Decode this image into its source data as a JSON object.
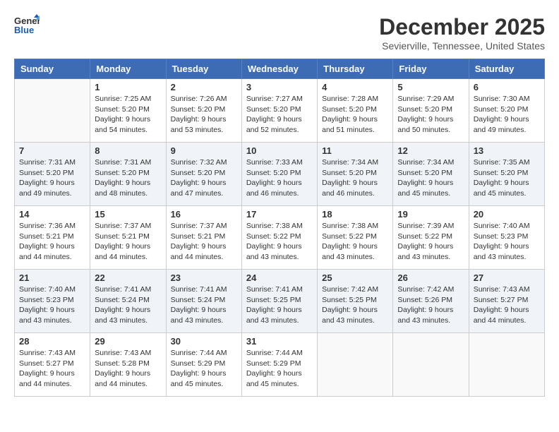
{
  "header": {
    "logo_line1": "General",
    "logo_line2": "Blue",
    "month_title": "December 2025",
    "location": "Sevierville, Tennessee, United States"
  },
  "columns": [
    "Sunday",
    "Monday",
    "Tuesday",
    "Wednesday",
    "Thursday",
    "Friday",
    "Saturday"
  ],
  "weeks": [
    [
      {
        "day": "",
        "info": ""
      },
      {
        "day": "1",
        "info": "Sunrise: 7:25 AM\nSunset: 5:20 PM\nDaylight: 9 hours\nand 54 minutes."
      },
      {
        "day": "2",
        "info": "Sunrise: 7:26 AM\nSunset: 5:20 PM\nDaylight: 9 hours\nand 53 minutes."
      },
      {
        "day": "3",
        "info": "Sunrise: 7:27 AM\nSunset: 5:20 PM\nDaylight: 9 hours\nand 52 minutes."
      },
      {
        "day": "4",
        "info": "Sunrise: 7:28 AM\nSunset: 5:20 PM\nDaylight: 9 hours\nand 51 minutes."
      },
      {
        "day": "5",
        "info": "Sunrise: 7:29 AM\nSunset: 5:20 PM\nDaylight: 9 hours\nand 50 minutes."
      },
      {
        "day": "6",
        "info": "Sunrise: 7:30 AM\nSunset: 5:20 PM\nDaylight: 9 hours\nand 49 minutes."
      }
    ],
    [
      {
        "day": "7",
        "info": "Sunrise: 7:31 AM\nSunset: 5:20 PM\nDaylight: 9 hours\nand 49 minutes."
      },
      {
        "day": "8",
        "info": "Sunrise: 7:31 AM\nSunset: 5:20 PM\nDaylight: 9 hours\nand 48 minutes."
      },
      {
        "day": "9",
        "info": "Sunrise: 7:32 AM\nSunset: 5:20 PM\nDaylight: 9 hours\nand 47 minutes."
      },
      {
        "day": "10",
        "info": "Sunrise: 7:33 AM\nSunset: 5:20 PM\nDaylight: 9 hours\nand 46 minutes."
      },
      {
        "day": "11",
        "info": "Sunrise: 7:34 AM\nSunset: 5:20 PM\nDaylight: 9 hours\nand 46 minutes."
      },
      {
        "day": "12",
        "info": "Sunrise: 7:34 AM\nSunset: 5:20 PM\nDaylight: 9 hours\nand 45 minutes."
      },
      {
        "day": "13",
        "info": "Sunrise: 7:35 AM\nSunset: 5:20 PM\nDaylight: 9 hours\nand 45 minutes."
      }
    ],
    [
      {
        "day": "14",
        "info": "Sunrise: 7:36 AM\nSunset: 5:21 PM\nDaylight: 9 hours\nand 44 minutes."
      },
      {
        "day": "15",
        "info": "Sunrise: 7:37 AM\nSunset: 5:21 PM\nDaylight: 9 hours\nand 44 minutes."
      },
      {
        "day": "16",
        "info": "Sunrise: 7:37 AM\nSunset: 5:21 PM\nDaylight: 9 hours\nand 44 minutes."
      },
      {
        "day": "17",
        "info": "Sunrise: 7:38 AM\nSunset: 5:22 PM\nDaylight: 9 hours\nand 43 minutes."
      },
      {
        "day": "18",
        "info": "Sunrise: 7:38 AM\nSunset: 5:22 PM\nDaylight: 9 hours\nand 43 minutes."
      },
      {
        "day": "19",
        "info": "Sunrise: 7:39 AM\nSunset: 5:22 PM\nDaylight: 9 hours\nand 43 minutes."
      },
      {
        "day": "20",
        "info": "Sunrise: 7:40 AM\nSunset: 5:23 PM\nDaylight: 9 hours\nand 43 minutes."
      }
    ],
    [
      {
        "day": "21",
        "info": "Sunrise: 7:40 AM\nSunset: 5:23 PM\nDaylight: 9 hours\nand 43 minutes."
      },
      {
        "day": "22",
        "info": "Sunrise: 7:41 AM\nSunset: 5:24 PM\nDaylight: 9 hours\nand 43 minutes."
      },
      {
        "day": "23",
        "info": "Sunrise: 7:41 AM\nSunset: 5:24 PM\nDaylight: 9 hours\nand 43 minutes."
      },
      {
        "day": "24",
        "info": "Sunrise: 7:41 AM\nSunset: 5:25 PM\nDaylight: 9 hours\nand 43 minutes."
      },
      {
        "day": "25",
        "info": "Sunrise: 7:42 AM\nSunset: 5:25 PM\nDaylight: 9 hours\nand 43 minutes."
      },
      {
        "day": "26",
        "info": "Sunrise: 7:42 AM\nSunset: 5:26 PM\nDaylight: 9 hours\nand 43 minutes."
      },
      {
        "day": "27",
        "info": "Sunrise: 7:43 AM\nSunset: 5:27 PM\nDaylight: 9 hours\nand 44 minutes."
      }
    ],
    [
      {
        "day": "28",
        "info": "Sunrise: 7:43 AM\nSunset: 5:27 PM\nDaylight: 9 hours\nand 44 minutes."
      },
      {
        "day": "29",
        "info": "Sunrise: 7:43 AM\nSunset: 5:28 PM\nDaylight: 9 hours\nand 44 minutes."
      },
      {
        "day": "30",
        "info": "Sunrise: 7:44 AM\nSunset: 5:29 PM\nDaylight: 9 hours\nand 45 minutes."
      },
      {
        "day": "31",
        "info": "Sunrise: 7:44 AM\nSunset: 5:29 PM\nDaylight: 9 hours\nand 45 minutes."
      },
      {
        "day": "",
        "info": ""
      },
      {
        "day": "",
        "info": ""
      },
      {
        "day": "",
        "info": ""
      }
    ]
  ]
}
